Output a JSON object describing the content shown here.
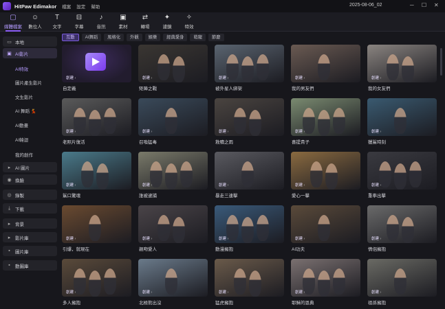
{
  "app": {
    "title": "HitPaw Edimakor",
    "menu": [
      "檔案",
      "設定",
      "幫助"
    ],
    "date": "2025-08-06_02",
    "controls": {
      "minimize": "─",
      "maximize": "☐",
      "close": "✕"
    }
  },
  "toolbar": [
    {
      "label": "媒體檔案",
      "icon": "folder-icon",
      "glyph": "▢",
      "active": true
    },
    {
      "label": "數位人",
      "icon": "avatar-icon",
      "glyph": "☺",
      "active": false
    },
    {
      "label": "文字",
      "icon": "text-icon",
      "glyph": "T",
      "active": false
    },
    {
      "label": "字幕",
      "icon": "subtitle-icon",
      "glyph": "⊟",
      "active": false
    },
    {
      "label": "音訊",
      "icon": "music-icon",
      "glyph": "♪",
      "active": false
    },
    {
      "label": "素材",
      "icon": "sticker-icon",
      "glyph": "▣",
      "active": false
    },
    {
      "label": "轉場",
      "icon": "transition-icon",
      "glyph": "⇄",
      "active": false
    },
    {
      "label": "濾鏡",
      "icon": "filter-icon",
      "glyph": "✦",
      "active": false
    },
    {
      "label": "特效",
      "icon": "effects-icon",
      "glyph": "✧",
      "active": false
    }
  ],
  "sidebar": {
    "items": [
      {
        "label": "本地",
        "icon": "folder-icon",
        "glyph": "▭",
        "active": false
      },
      {
        "label": "AI影片",
        "icon": "ai-video-icon",
        "glyph": "▣",
        "active": true
      },
      {
        "label": "AI 圖片",
        "icon": "ai-image-icon",
        "glyph": "▸",
        "active": false
      },
      {
        "label": "換臉",
        "icon": "face-swap-icon",
        "glyph": "◉",
        "active": false
      },
      {
        "label": "錄製",
        "icon": "record-icon",
        "glyph": "◎",
        "active": false
      },
      {
        "label": "下載",
        "icon": "download-icon",
        "glyph": "⤓",
        "active": false
      },
      {
        "label": "背景",
        "icon": "background-icon",
        "glyph": "▸",
        "active": false
      },
      {
        "label": "影片庫",
        "icon": "video-library-icon",
        "glyph": "▸",
        "active": false
      },
      {
        "label": "圖片庫",
        "icon": "image-library-icon",
        "glyph": "▪",
        "active": false
      },
      {
        "label": "動圖庫",
        "icon": "gif-library-icon",
        "glyph": "▪",
        "active": false
      }
    ],
    "subitems": [
      {
        "label": "AI特效",
        "active": true
      },
      {
        "label": "圖片產生影片",
        "active": false
      },
      {
        "label": "文生影片",
        "active": false
      },
      {
        "label": "AI 舞蹈 💃",
        "active": false
      },
      {
        "label": "AI動畫",
        "active": false
      },
      {
        "label": "AI韓迴",
        "active": false
      },
      {
        "label": "我的創作",
        "active": false
      }
    ]
  },
  "tags": [
    {
      "label": "互動",
      "active": true
    },
    {
      "label": "AI舞蹈",
      "active": false
    },
    {
      "label": "風格化",
      "active": false
    },
    {
      "label": "外觀",
      "active": false
    },
    {
      "label": "娛樂",
      "active": false
    },
    {
      "label": "經典愛身",
      "active": false
    },
    {
      "label": "萌寵",
      "active": false
    },
    {
      "label": "節慶",
      "active": false
    }
  ],
  "create_label": "創建",
  "cards": [
    {
      "title": "自定義",
      "bg": "#1e1a28",
      "custom": true
    },
    {
      "title": "矩陣之戰",
      "bg": "#3a3632"
    },
    {
      "title": "被外星人綁架",
      "bg": "#5a6470"
    },
    {
      "title": "我的男友們",
      "bg": "#6a5a52"
    },
    {
      "title": "我的女友們",
      "bg": "#8a8480"
    },
    {
      "title": "老照片復活",
      "bg": "#5a5a5a"
    },
    {
      "title": "召喚猛毒",
      "bg": "#3a4a5a"
    },
    {
      "title": "救贖之雨",
      "bg": "#4a4440"
    },
    {
      "title": "喜提貴子",
      "bg": "#7a8a70"
    },
    {
      "title": "獵鯊時刻",
      "bg": "#3a5a70"
    },
    {
      "title": "鯊口驚魂",
      "bg": "#4a7a8a"
    },
    {
      "title": "誰被逮捕",
      "bg": "#7a7a6a"
    },
    {
      "title": "暴走三連擊",
      "bg": "#5a5a60"
    },
    {
      "title": "愛心一擊",
      "bg": "#8a6a40"
    },
    {
      "title": "重拳出擊",
      "bg": "#3a3a40"
    },
    {
      "title": "引爆，就現在",
      "bg": "#6a4a30"
    },
    {
      "title": "親吻愛人",
      "bg": "#4a4448"
    },
    {
      "title": "動漫擁抱",
      "bg": "#3a5a7a"
    },
    {
      "title": "AI功夫",
      "bg": "#5a4a3a"
    },
    {
      "title": "情侶擁抱",
      "bg": "#6a6a6a"
    },
    {
      "title": "多人擁抱",
      "bg": "#5a4a3a"
    },
    {
      "title": "北極熊出沒",
      "bg": "#6a7a8a"
    },
    {
      "title": "猛虎擁抱",
      "bg": "#6a5a4a"
    },
    {
      "title": "耶穌的恩典",
      "bg": "#7a7070"
    },
    {
      "title": "祖孫擁抱",
      "bg": "#6a6a64"
    }
  ]
}
